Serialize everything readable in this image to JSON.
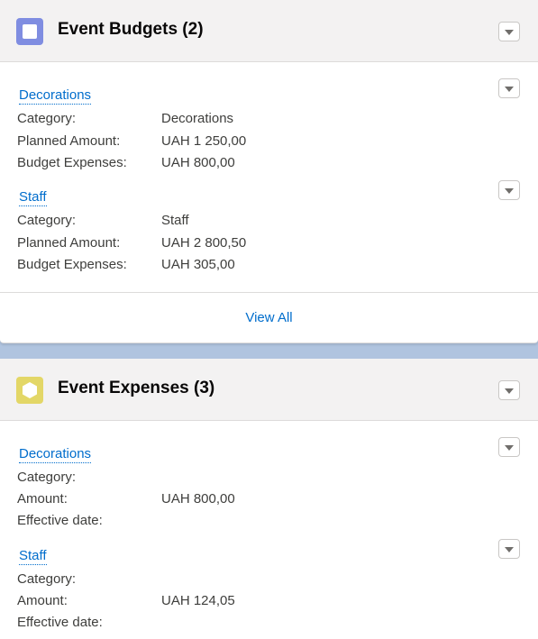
{
  "colors": {
    "budget_icon": "#7f8de1",
    "expense_icon": "#e3d767",
    "link": "#006dcc",
    "header_bg": "#f3f2f2",
    "page_bg": "#b0c4df"
  },
  "budgets": {
    "title": "Event Budgets (2)",
    "icon": "square-icon",
    "records": [
      {
        "name": "Decorations",
        "fields": [
          {
            "label": "Category:",
            "value": "Decorations"
          },
          {
            "label": "Planned Amount:",
            "value": "UAH 1 250,00"
          },
          {
            "label": "Budget Expenses:",
            "value": "UAH 800,00"
          }
        ]
      },
      {
        "name": "Staff",
        "fields": [
          {
            "label": "Category:",
            "value": "Staff"
          },
          {
            "label": "Planned Amount:",
            "value": "UAH 2 800,50"
          },
          {
            "label": "Budget Expenses:",
            "value": "UAH 305,00"
          }
        ]
      }
    ],
    "view_all": "View All"
  },
  "expenses": {
    "title": "Event Expenses (3)",
    "icon": "hexagon-icon",
    "records": [
      {
        "name": "Decorations",
        "fields": [
          {
            "label": "Category:",
            "value": ""
          },
          {
            "label": "Amount:",
            "value": "UAH 800,00"
          },
          {
            "label": "Effective date:",
            "value": ""
          }
        ]
      },
      {
        "name": "Staff",
        "fields": [
          {
            "label": "Category:",
            "value": ""
          },
          {
            "label": "Amount:",
            "value": "UAH 124,05"
          },
          {
            "label": "Effective date:",
            "value": ""
          }
        ]
      }
    ]
  }
}
